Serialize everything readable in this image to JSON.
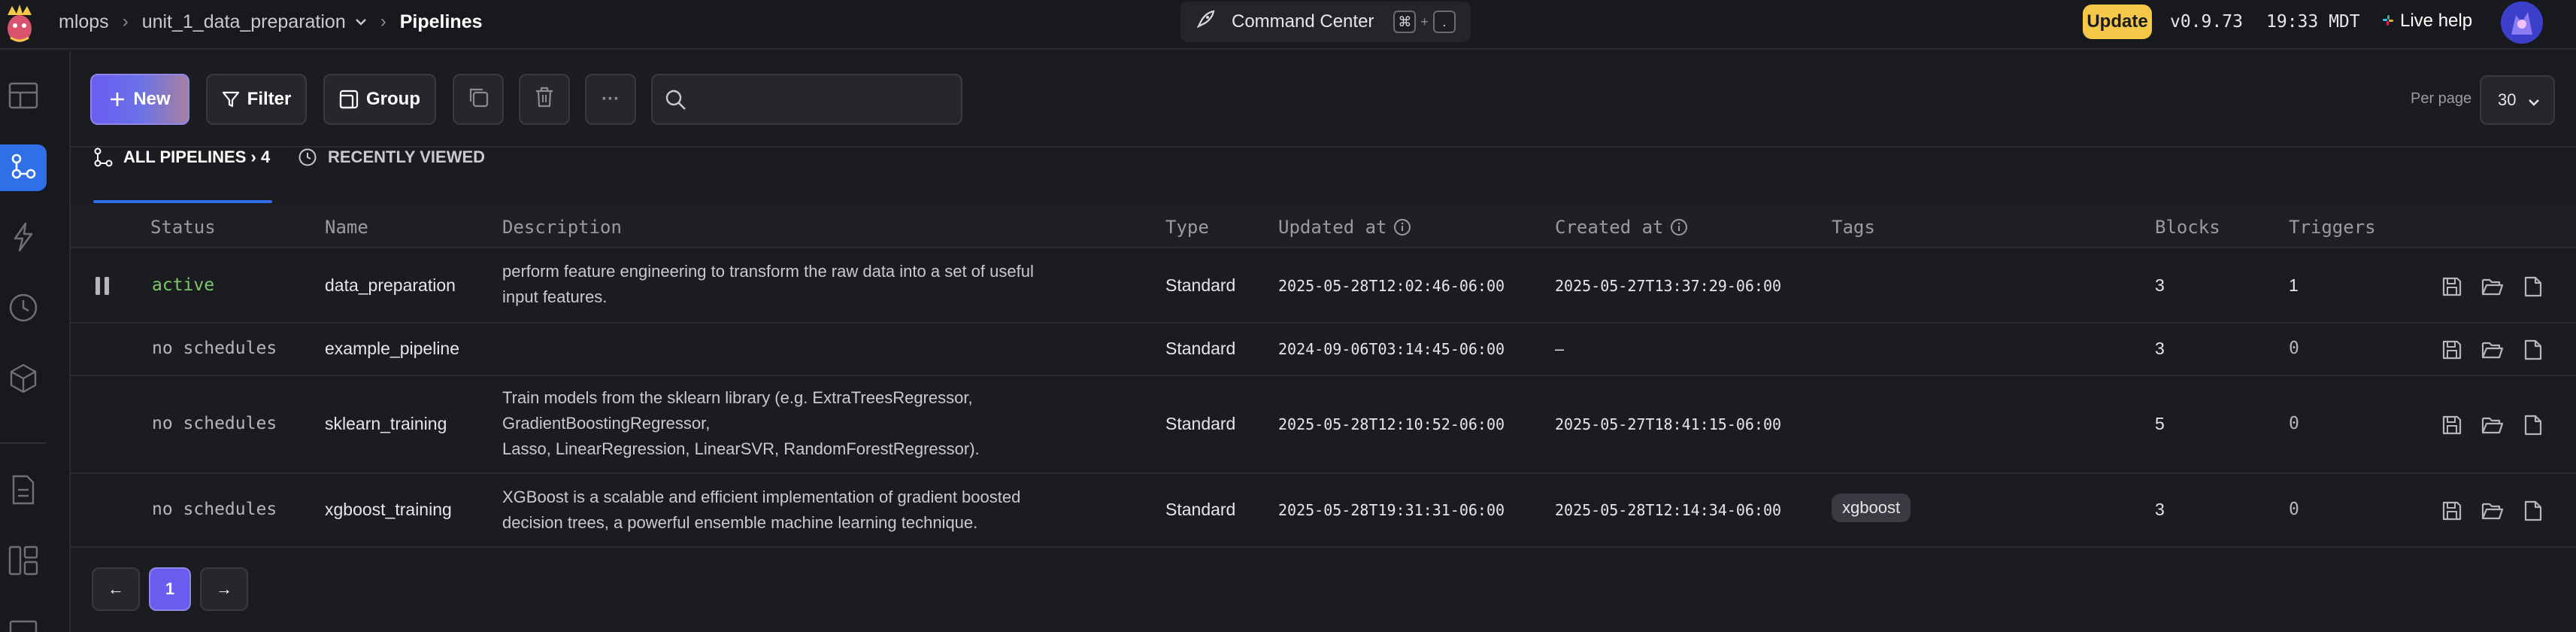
{
  "header": {
    "breadcrumbs": [
      "mlops",
      "unit_1_data_preparation",
      "Pipelines"
    ],
    "command_center": {
      "label": "Command Center",
      "key1": "⌘",
      "key_plus": "+",
      "key2": "."
    },
    "update_label": "Update",
    "version": "v0.9.73",
    "time": "19:33 MDT",
    "live_help": "Live help"
  },
  "toolbar": {
    "new_label": "New",
    "filter_label": "Filter",
    "group_label": "Group",
    "more_label": "···",
    "search_placeholder": "",
    "per_page_label": "Per page",
    "per_page_value": "30"
  },
  "tabs": {
    "all_label": "ALL PIPELINES › 4",
    "recent_label": "RECENTLY VIEWED"
  },
  "table": {
    "columns": {
      "status": "Status",
      "name": "Name",
      "description": "Description",
      "type": "Type",
      "updated_at": "Updated at",
      "created_at": "Created at",
      "tags": "Tags",
      "blocks": "Blocks",
      "triggers": "Triggers"
    },
    "rows": [
      {
        "status": "active",
        "name": "data_preparation",
        "description": "perform feature engineering to transform the raw data into a set of useful\ninput features.",
        "type": "Standard",
        "updated_at": "2025-05-28T12:02:46-06:00",
        "created_at": "2025-05-27T13:37:29-06:00",
        "tag": "",
        "blocks": "3",
        "triggers": "1"
      },
      {
        "status": "no schedules",
        "name": "example_pipeline",
        "description": "",
        "type": "Standard",
        "updated_at": "2024-09-06T03:14:45-06:00",
        "created_at": "—",
        "tag": "",
        "blocks": "3",
        "triggers": "0"
      },
      {
        "status": "no schedules",
        "name": "sklearn_training",
        "description": "Train models from the sklearn library (e.g. ExtraTreesRegressor,\nGradientBoostingRegressor,\n  Lasso, LinearRegression, LinearSVR, RandomForestRegressor).",
        "type": "Standard",
        "updated_at": "2025-05-28T12:10:52-06:00",
        "created_at": "2025-05-27T18:41:15-06:00",
        "tag": "",
        "blocks": "5",
        "triggers": "0"
      },
      {
        "status": "no schedules",
        "name": "xgboost_training",
        "description": "XGBoost is a scalable and efficient implementation of gradient boosted\n  decision trees, a powerful ensemble machine learning technique.",
        "type": "Standard",
        "updated_at": "2025-05-28T19:31:31-06:00",
        "created_at": "2025-05-28T12:14:34-06:00",
        "tag": "xgboost",
        "blocks": "3",
        "triggers": "0"
      }
    ]
  },
  "pagination": {
    "prev": "←",
    "current": "1",
    "next": "→"
  },
  "colors": {
    "accent_purple": "#6b5cf0",
    "accent_blue": "#2f6fe8",
    "active_green": "#7dc86a",
    "update_yellow": "#f5c84a"
  },
  "icons": {
    "sidebar": [
      "layout-icon",
      "pipelines-icon",
      "lightning-icon",
      "clock-icon",
      "cube-icon",
      "document-icon",
      "split-view-icon"
    ]
  }
}
